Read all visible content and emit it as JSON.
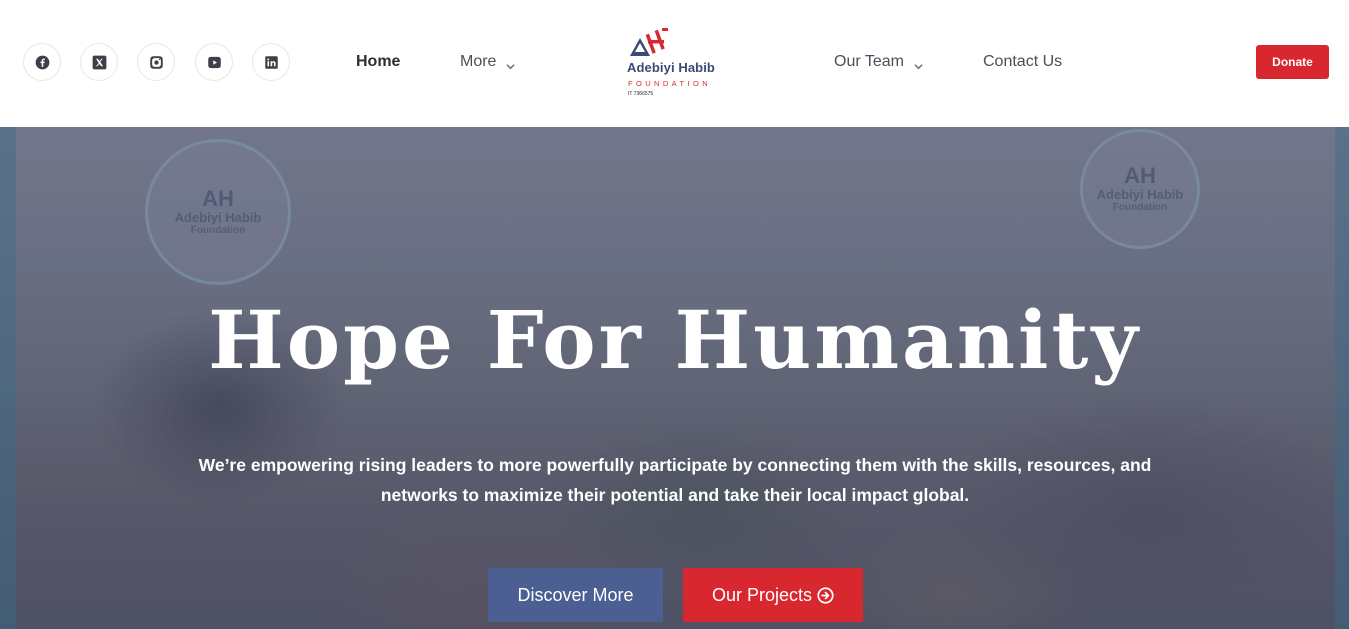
{
  "header": {
    "social_icons": [
      "facebook-icon",
      "x-twitter-icon",
      "instagram-icon",
      "youtube-icon",
      "linkedin-icon"
    ],
    "nav": {
      "home": "Home",
      "more": "More",
      "our_team": "Our Team",
      "contact_us": "Contact Us"
    },
    "logo": {
      "mark": "AH",
      "name": "Adebiyi Habib",
      "subtitle": "FOUNDATION",
      "registration": "IT 7366575"
    },
    "donate_label": "Donate"
  },
  "hero": {
    "title": "Hope For Humanity",
    "description": "We’re empowering rising leaders to more powerfully participate by connecting them with the skills, resources, and networks to maximize their potential and take their local impact global.",
    "discover_label": "Discover More",
    "projects_label": "Our Projects",
    "banner_logo": {
      "mark": "AH",
      "name": "Adebiyi Habib",
      "sub": "Foundation"
    }
  },
  "colors": {
    "brand_red": "#d9272f",
    "brand_blue": "#4b5f93",
    "logo_navy": "#3b4a74"
  }
}
